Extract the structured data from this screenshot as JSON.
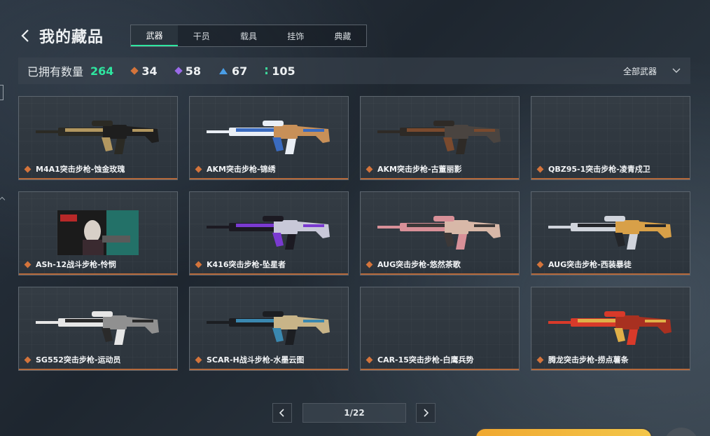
{
  "header": {
    "title": "我的藏品"
  },
  "tabs": [
    {
      "label": "武器",
      "active": true
    },
    {
      "label": "干员",
      "active": false
    },
    {
      "label": "载具",
      "active": false
    },
    {
      "label": "挂饰",
      "active": false
    },
    {
      "label": "典藏",
      "active": false
    }
  ],
  "stats": {
    "label": "已拥有数量",
    "total": "264",
    "total_color": "#2ee6a0",
    "rarities": [
      {
        "icon": "orange-diamond-icon",
        "color": "#d4743b",
        "count": "34"
      },
      {
        "icon": "purple-diamond-icon",
        "color": "#9a6ae8",
        "count": "58"
      },
      {
        "icon": "blue-triangle-icon",
        "color": "#4a9ee6",
        "count": "67"
      },
      {
        "icon": "green-bar-icon",
        "color": "#3dd69a",
        "count": "105"
      }
    ],
    "filter_label": "全部武器"
  },
  "items": [
    {
      "name": "M4A1突击步枪-蚀金玫瑰",
      "palette": [
        "#2b2a24",
        "#b29760",
        "#1e1e1e"
      ]
    },
    {
      "name": "AKM突击步枪-锦绣",
      "palette": [
        "#e9eef5",
        "#3a6bc0",
        "#c89058"
      ]
    },
    {
      "name": "AKM突击步枪-古董丽影",
      "palette": [
        "#2e2a26",
        "#7a4a2e",
        "#4a4440"
      ]
    },
    {
      "name": "QBZ95-1突击步枪-凌青戍卫",
      "palette": []
    },
    {
      "name": "ASh-12战斗步枪-怜悯",
      "palette": [
        "#1b1b1b",
        "#b82828",
        "#2ab8a8"
      ]
    },
    {
      "name": "K416突击步枪-坠星者",
      "palette": [
        "#1c1a22",
        "#7a3ad0",
        "#c8c8d8"
      ]
    },
    {
      "name": "AUG突击步枪-悠然茶歌",
      "palette": [
        "#d89098",
        "#3c3838",
        "#d8b8a8"
      ]
    },
    {
      "name": "AUG突击步枪-西装暴徒",
      "palette": [
        "#d0d4dc",
        "#24262a",
        "#d8a048"
      ]
    },
    {
      "name": "SG552突击步枪-运动员",
      "palette": [
        "#e6e6e6",
        "#2a2a2a",
        "#909090"
      ]
    },
    {
      "name": "SCAR-H战斗步枪-水墨云图",
      "palette": [
        "#1c1e22",
        "#3a88b0",
        "#c8b488"
      ]
    },
    {
      "name": "CAR-15突击步枪-白鹰兵势",
      "palette": []
    },
    {
      "name": "腾龙突击步枪-捞点薯条",
      "palette": [
        "#d83a2a",
        "#e0b048",
        "#a83020"
      ]
    }
  ],
  "pagination": {
    "current": "1/22"
  }
}
